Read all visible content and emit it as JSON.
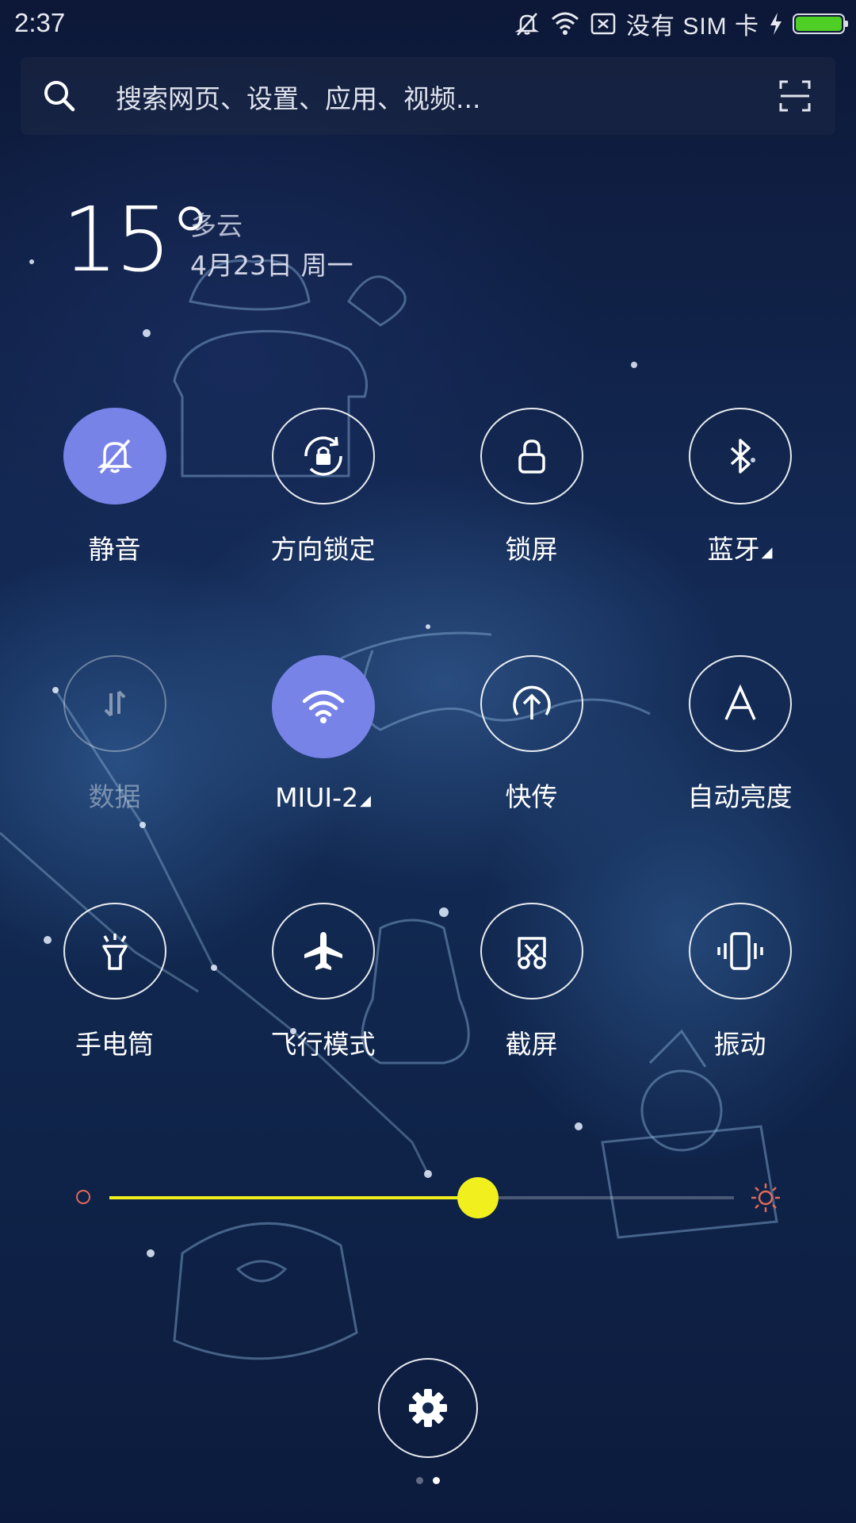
{
  "status_bar": {
    "time": "2:37",
    "sim_text": "没有 SIM 卡",
    "icons": [
      "silent-bell-icon",
      "wifi-icon",
      "no-sim-icon",
      "charging-bolt-icon",
      "battery-icon"
    ],
    "battery_color": "#4fcf25"
  },
  "search": {
    "placeholder": "搜索网页、设置、应用、视频...",
    "icons": [
      "search-icon",
      "scan-icon"
    ]
  },
  "weather": {
    "temperature": "15°",
    "condition": "多云",
    "date": "4月23日 周一"
  },
  "toggles": [
    {
      "label": "静音",
      "icon": "silent-bell-icon",
      "state": "on"
    },
    {
      "label": "方向锁定",
      "icon": "rotation-lock-icon",
      "state": "off"
    },
    {
      "label": "锁屏",
      "icon": "lock-icon",
      "state": "off"
    },
    {
      "label": "蓝牙",
      "icon": "bluetooth-icon",
      "state": "off",
      "has_menu": true
    },
    {
      "label": "数据",
      "icon": "mobile-data-icon",
      "state": "disabled"
    },
    {
      "label": "MIUI-2",
      "icon": "wifi-icon",
      "state": "on",
      "has_menu": true
    },
    {
      "label": "快传",
      "icon": "transfer-upload-icon",
      "state": "off"
    },
    {
      "label": "自动亮度",
      "icon": "auto-brightness-icon",
      "state": "off"
    },
    {
      "label": "手电筒",
      "icon": "flashlight-icon",
      "state": "off"
    },
    {
      "label": "飞行模式",
      "icon": "airplane-icon",
      "state": "off"
    },
    {
      "label": "截屏",
      "icon": "screenshot-icon",
      "state": "off"
    },
    {
      "label": "振动",
      "icon": "vibrate-icon",
      "state": "off"
    }
  ],
  "brightness": {
    "level": 0.59,
    "color": "#f1ef1d",
    "icons": [
      "brightness-low-icon",
      "brightness-high-icon"
    ]
  },
  "settings": {
    "icon": "gear-icon"
  },
  "pager": {
    "pages": 2,
    "current": 2
  },
  "colors": {
    "accent": "#7883e8"
  }
}
